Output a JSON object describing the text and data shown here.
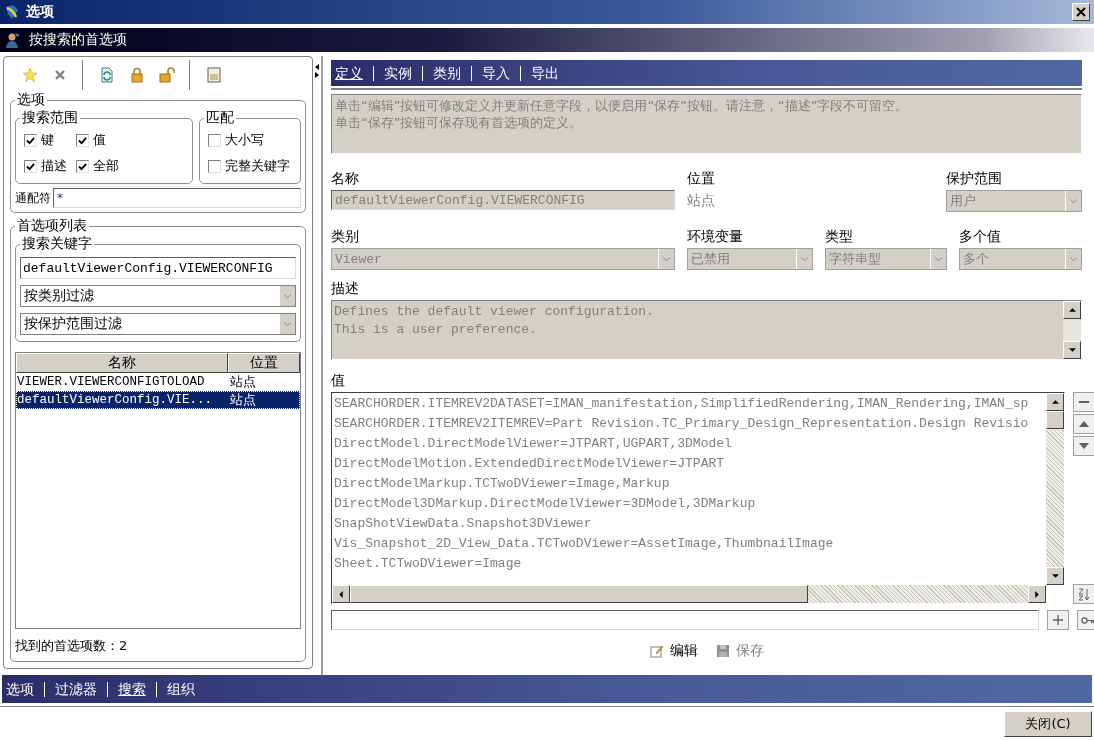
{
  "window": {
    "title": "选项"
  },
  "header": {
    "title": "按搜索的首选项"
  },
  "options": {
    "title": "选项",
    "scope": {
      "title": "搜索范围",
      "items": [
        {
          "label": "键",
          "checked": true
        },
        {
          "label": "值",
          "checked": true
        },
        {
          "label": "描述",
          "checked": true
        },
        {
          "label": "全部",
          "checked": true
        }
      ]
    },
    "match": {
      "title": "匹配",
      "items": [
        {
          "label": "大小写",
          "checked": false
        },
        {
          "label": "完整关键字",
          "checked": false
        }
      ]
    },
    "wildcard": {
      "label": "通配符",
      "value": "*"
    }
  },
  "preference_list": {
    "title": "首选项列表",
    "search": {
      "title": "搜索关键字",
      "value": "defaultViewerConfig.VIEWERCONFIG"
    },
    "filters": [
      "按类别过滤",
      "按保护范围过滤"
    ],
    "columns": [
      "名称",
      "位置"
    ],
    "rows": [
      {
        "name": "VIEWER.VIEWERCONFIGTOLOAD",
        "location": "站点",
        "selected": false
      },
      {
        "name": "defaultViewerConfig.VIE...",
        "location": "站点",
        "selected": true
      }
    ],
    "found": "找到的首选项数：2"
  },
  "tabs": [
    {
      "label": "定义",
      "selected": true
    },
    {
      "label": "实例",
      "selected": false
    },
    {
      "label": "类别",
      "selected": false
    },
    {
      "label": "导入",
      "selected": false
    },
    {
      "label": "导出",
      "selected": false
    }
  ],
  "info": [
    "单击“编辑”按钮可修改定义并更新任意字段，以便启用“保存”按钮。请注意，“描述”字段不可留空。",
    "单击“保存”按钮可保存现有首选项的定义。"
  ],
  "field_rows": [
    [
      {
        "kind": "text",
        "label": "名称",
        "value": "defaultViewerConfig.VIEWERCONFIG",
        "disabled": true
      },
      {
        "kind": "plain",
        "label": "位置",
        "value": "站点",
        "disabled": true
      },
      {
        "kind": "select",
        "label": "保护范围",
        "value": "用户",
        "disabled": true
      }
    ],
    [
      {
        "kind": "select",
        "label": "类别",
        "value": "Viewer",
        "disabled": true
      },
      {
        "kind": "select",
        "label": "环境变量",
        "value": "已禁用",
        "disabled": true
      },
      {
        "kind": "select",
        "label": "类型",
        "value": "字符串型",
        "disabled": true
      },
      {
        "kind": "select",
        "label": "多个值",
        "value": "多个",
        "disabled": true
      }
    ]
  ],
  "description": {
    "label": "描述",
    "lines": [
      "Defines the default viewer configuration.",
      "This is a user preference."
    ],
    "disabled": true
  },
  "values": {
    "label": "值",
    "lines": [
      "SEARCHORDER.ITEMREV2DATASET=IMAN_manifestation,SimplifiedRendering,IMAN_Rendering,IMAN_sp",
      "SEARCHORDER.ITEMREV2ITEMREV=Part Revision.TC_Primary_Design_Representation.Design Revisio",
      "DirectModel.DirectModelViewer=JTPART,UGPART,3DModel",
      "DirectModelMotion.ExtendedDirectModelViewer=JTPART",
      "DirectModelMarkup.TCTwoDViewer=Image,Markup",
      "DirectModel3DMarkup.DirectModelViewer=3DModel,3DMarkup",
      "SnapShotViewData.Snapshot3DViewer",
      "Vis_Snapshot_2D_View_Data.TCTwoDViewer=AssetImage,ThumbnailImage",
      "Sheet.TCTwoDViewer=Image"
    ],
    "disabled": true
  },
  "actions": [
    {
      "kind": "edit",
      "label": "编辑",
      "disabled": false
    },
    {
      "kind": "save",
      "label": "保存",
      "disabled": true
    }
  ],
  "bottom_tabs": [
    {
      "label": "选项",
      "selected": false
    },
    {
      "label": "过滤器",
      "selected": false
    },
    {
      "label": "搜索",
      "selected": true
    },
    {
      "label": "组织",
      "selected": false
    }
  ],
  "close_button": "关闭(C)"
}
